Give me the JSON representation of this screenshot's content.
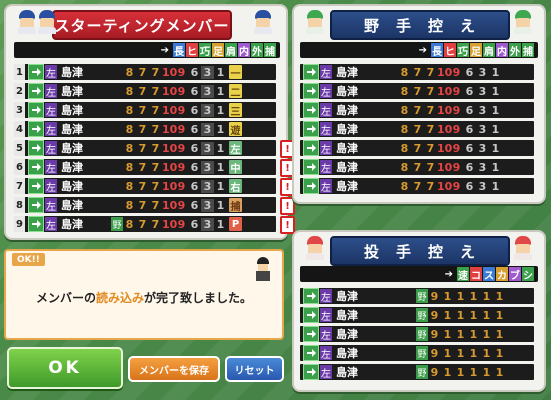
{
  "starting": {
    "title": "スターティングメンバー",
    "columns": [
      "長",
      "ヒ",
      "巧",
      "足",
      "肩",
      "内",
      "外",
      "捕"
    ],
    "rows": [
      {
        "num": "1",
        "hand": "左",
        "name": "島津",
        "tag": "",
        "stats": [
          "8",
          "7",
          "7",
          "10",
          "9",
          "6",
          "3",
          "1"
        ],
        "pos": "一",
        "pos_color": "yel",
        "warn": false
      },
      {
        "num": "2",
        "hand": "左",
        "name": "島津",
        "tag": "",
        "stats": [
          "8",
          "7",
          "7",
          "10",
          "9",
          "6",
          "3",
          "1"
        ],
        "pos": "二",
        "pos_color": "yel",
        "warn": false
      },
      {
        "num": "3",
        "hand": "左",
        "name": "島津",
        "tag": "",
        "stats": [
          "8",
          "7",
          "7",
          "10",
          "9",
          "6",
          "3",
          "1"
        ],
        "pos": "三",
        "pos_color": "yel",
        "warn": false
      },
      {
        "num": "4",
        "hand": "左",
        "name": "島津",
        "tag": "",
        "stats": [
          "8",
          "7",
          "7",
          "10",
          "9",
          "6",
          "3",
          "1"
        ],
        "pos": "遊",
        "pos_color": "yel",
        "warn": false
      },
      {
        "num": "5",
        "hand": "左",
        "name": "島津",
        "tag": "",
        "stats": [
          "8",
          "7",
          "7",
          "10",
          "9",
          "6",
          "3",
          "1"
        ],
        "pos": "左",
        "pos_color": "grn",
        "warn": true
      },
      {
        "num": "6",
        "hand": "左",
        "name": "島津",
        "tag": "",
        "stats": [
          "8",
          "7",
          "7",
          "10",
          "9",
          "6",
          "3",
          "1"
        ],
        "pos": "中",
        "pos_color": "grn",
        "warn": true
      },
      {
        "num": "7",
        "hand": "左",
        "name": "島津",
        "tag": "",
        "stats": [
          "8",
          "7",
          "7",
          "10",
          "9",
          "6",
          "3",
          "1"
        ],
        "pos": "右",
        "pos_color": "grn",
        "warn": true
      },
      {
        "num": "8",
        "hand": "左",
        "name": "島津",
        "tag": "",
        "stats": [
          "8",
          "7",
          "7",
          "10",
          "9",
          "6",
          "3",
          "1"
        ],
        "pos": "捕",
        "pos_color": "brn",
        "warn": true
      },
      {
        "num": "9",
        "hand": "左",
        "name": "島津",
        "tag": "野",
        "stats": [
          "8",
          "7",
          "7",
          "10",
          "9",
          "6",
          "3",
          "1"
        ],
        "pos": "P",
        "pos_color": "pch",
        "warn": true
      }
    ]
  },
  "bench": {
    "title": "野　手　控　え",
    "columns": [
      "長",
      "ヒ",
      "巧",
      "足",
      "肩",
      "内",
      "外",
      "捕"
    ],
    "rows": [
      {
        "hand": "左",
        "name": "島津",
        "tag": "",
        "stats": [
          "8",
          "7",
          "7",
          "10",
          "9",
          "6",
          "3",
          "1"
        ]
      },
      {
        "hand": "左",
        "name": "島津",
        "tag": "",
        "stats": [
          "8",
          "7",
          "7",
          "10",
          "9",
          "6",
          "3",
          "1"
        ]
      },
      {
        "hand": "左",
        "name": "島津",
        "tag": "",
        "stats": [
          "8",
          "7",
          "7",
          "10",
          "9",
          "6",
          "3",
          "1"
        ]
      },
      {
        "hand": "左",
        "name": "島津",
        "tag": "",
        "stats": [
          "8",
          "7",
          "7",
          "10",
          "9",
          "6",
          "3",
          "1"
        ]
      },
      {
        "hand": "左",
        "name": "島津",
        "tag": "",
        "stats": [
          "8",
          "7",
          "7",
          "10",
          "9",
          "6",
          "3",
          "1"
        ]
      },
      {
        "hand": "左",
        "name": "島津",
        "tag": "",
        "stats": [
          "8",
          "7",
          "7",
          "10",
          "9",
          "6",
          "3",
          "1"
        ]
      },
      {
        "hand": "左",
        "name": "島津",
        "tag": "",
        "stats": [
          "8",
          "7",
          "7",
          "10",
          "9",
          "6",
          "3",
          "1"
        ]
      }
    ]
  },
  "pitchers": {
    "title": "投　手　控　え",
    "columns": [
      "速",
      "コ",
      "ス",
      "カ",
      "ブ",
      "シ"
    ],
    "rows": [
      {
        "hand": "左",
        "name": "島津",
        "tag": "野",
        "stats": [
          "9",
          "1",
          "1",
          "1",
          "1",
          "1"
        ]
      },
      {
        "hand": "左",
        "name": "島津",
        "tag": "野",
        "stats": [
          "9",
          "1",
          "1",
          "1",
          "1",
          "1"
        ]
      },
      {
        "hand": "左",
        "name": "島津",
        "tag": "野",
        "stats": [
          "9",
          "1",
          "1",
          "1",
          "1",
          "1"
        ]
      },
      {
        "hand": "左",
        "name": "島津",
        "tag": "野",
        "stats": [
          "9",
          "1",
          "1",
          "1",
          "1",
          "1"
        ]
      },
      {
        "hand": "左",
        "name": "島津",
        "tag": "野",
        "stats": [
          "9",
          "1",
          "1",
          "1",
          "1",
          "1"
        ]
      }
    ]
  },
  "message": {
    "badge": "OK!!",
    "text_before": "メンバーの",
    "text_emphasis": "読み込み",
    "text_after": "が完了致しました。"
  },
  "buttons": {
    "ok": "OK",
    "save": "メンバーを保存",
    "reset": "リセット"
  },
  "colors": {
    "red_header": "#c0232c",
    "blue_header": "#1f3a6e",
    "stat_gold": "#d79a30",
    "stat_red": "#e64545"
  },
  "icons": [
    "swap-arrow-icon",
    "mascot-icon",
    "warning-icon",
    "cursor-arrow-icon"
  ]
}
